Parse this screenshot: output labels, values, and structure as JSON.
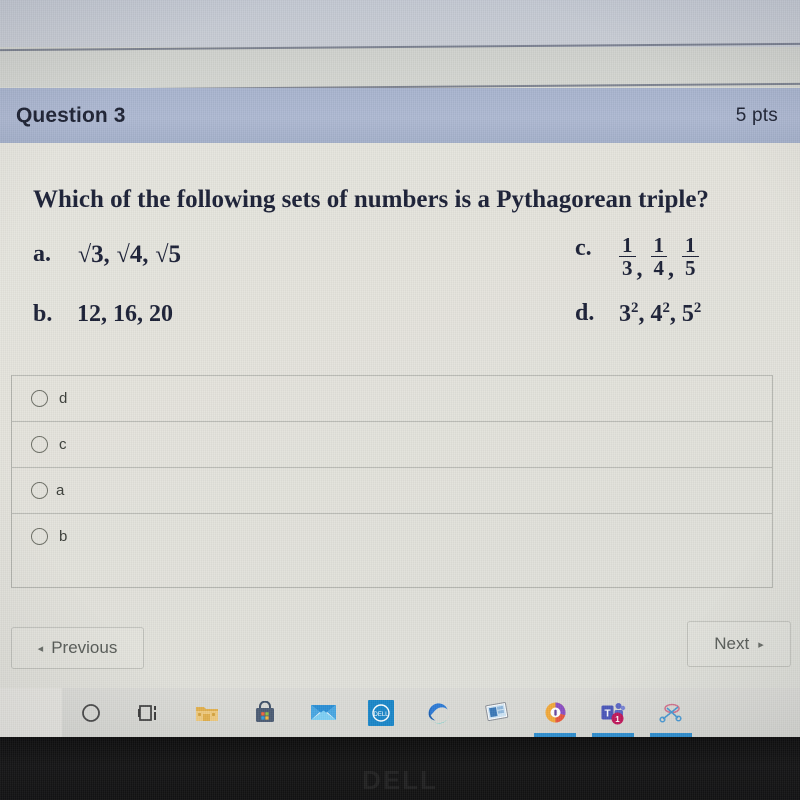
{
  "quiz": {
    "header": {
      "question_title": "Question 3",
      "points": "5 pts"
    },
    "stem": "Which of the following sets of numbers is a Pythagorean triple?",
    "choices": [
      {
        "letter": "a.",
        "kind": "radicals",
        "value": "√3, √4, √5",
        "parts": [
          "3",
          "4",
          "5"
        ]
      },
      {
        "letter": "b.",
        "kind": "plain",
        "value": "12, 16, 20"
      },
      {
        "letter": "c.",
        "kind": "fractions",
        "value": "1/3, 1/4, 1/5",
        "fractions": [
          {
            "num": "1",
            "den": "3"
          },
          {
            "num": "1",
            "den": "4"
          },
          {
            "num": "1",
            "den": "5"
          }
        ]
      },
      {
        "letter": "d.",
        "kind": "powers",
        "value": "3², 4², 5²",
        "powers": [
          {
            "base": "3",
            "exp": "2"
          },
          {
            "base": "4",
            "exp": "2"
          },
          {
            "base": "5",
            "exp": "2"
          }
        ]
      }
    ],
    "answer_options": [
      {
        "label": "d",
        "selected": false
      },
      {
        "label": "c",
        "selected": false
      },
      {
        "label": "a",
        "selected": false
      },
      {
        "label": "b",
        "selected": false
      }
    ],
    "nav": {
      "previous_label": "Previous",
      "previous_arrow": "◂",
      "next_label": "Next",
      "next_arrow": "▸"
    }
  },
  "taskbar": {
    "items": [
      {
        "name": "cortana-search-icon",
        "glyph": "circle",
        "running": false,
        "badge": null
      },
      {
        "name": "task-view-icon",
        "glyph": "taskview",
        "running": false,
        "badge": null
      },
      {
        "name": "file-explorer-icon",
        "glyph": "folder",
        "running": false,
        "badge": null
      },
      {
        "name": "microsoft-store-icon",
        "glyph": "store",
        "running": false,
        "badge": null
      },
      {
        "name": "mail-icon",
        "glyph": "mail",
        "running": false,
        "badge": null
      },
      {
        "name": "dell-icon",
        "glyph": "dell",
        "running": false,
        "badge": null
      },
      {
        "name": "microsoft-edge-icon",
        "glyph": "edge",
        "running": false,
        "badge": null
      },
      {
        "name": "remote-desktop-icon",
        "glyph": "window",
        "running": false,
        "badge": null
      },
      {
        "name": "security-shield-icon",
        "glyph": "shield",
        "running": true,
        "badge": null
      },
      {
        "name": "microsoft-teams-icon",
        "glyph": "teams",
        "running": true,
        "badge": "1"
      },
      {
        "name": "snip-and-sketch-icon",
        "glyph": "scissors",
        "running": true,
        "badge": null
      }
    ]
  },
  "device": {
    "brand_logo": "DELL"
  },
  "colors": {
    "header_bar": "#aeb9d2",
    "page_background": "#e4e3dc",
    "text_primary": "#1b2036",
    "text_muted": "#585c58",
    "taskbar": "#d9dad5",
    "running_indicator": "#2f8fd0",
    "bezel": "#101010"
  }
}
